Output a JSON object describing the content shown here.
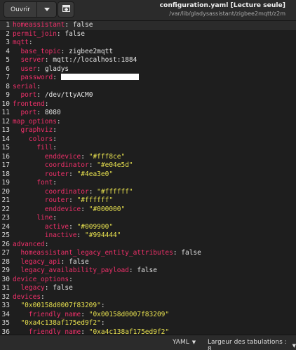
{
  "header": {
    "open_label": "Ouvrir",
    "open_menu_icon": "chevron-down-icon",
    "new_tab_icon": "new-document-icon",
    "title": "configuration.yaml [Lecture seule]",
    "path": "/var/lib/gladysassistant/zigbee2mqtt/z2m"
  },
  "editor": {
    "current_line": 1,
    "lines": [
      {
        "n": "1",
        "indent": "",
        "key": "homeassistant",
        "value": "false",
        "vtype": "plain"
      },
      {
        "n": "2",
        "indent": "",
        "key": "permit_join",
        "value": "false",
        "vtype": "plain"
      },
      {
        "n": "3",
        "indent": "",
        "key": "mqtt",
        "value": "",
        "vtype": "plain"
      },
      {
        "n": "4",
        "indent": "  ",
        "key": "base_topic",
        "value": "zigbee2mqtt",
        "vtype": "plain"
      },
      {
        "n": "5",
        "indent": "  ",
        "key": "server",
        "value": "mqtt://localhost:1884",
        "vtype": "plain"
      },
      {
        "n": "6",
        "indent": "  ",
        "key": "user",
        "value": "gladys",
        "vtype": "plain"
      },
      {
        "n": "7",
        "indent": "  ",
        "key": "password",
        "value": "",
        "vtype": "redacted"
      },
      {
        "n": "8",
        "indent": "",
        "key": "serial",
        "value": "",
        "vtype": "plain"
      },
      {
        "n": "9",
        "indent": "  ",
        "key": "port",
        "value": "/dev/ttyACM0",
        "vtype": "plain"
      },
      {
        "n": "10",
        "indent": "",
        "key": "frontend",
        "value": "",
        "vtype": "plain"
      },
      {
        "n": "11",
        "indent": "  ",
        "key": "port",
        "value": "8080",
        "vtype": "plain"
      },
      {
        "n": "12",
        "indent": "",
        "key": "map_options",
        "value": "",
        "vtype": "plain"
      },
      {
        "n": "13",
        "indent": "  ",
        "key": "graphviz",
        "value": "",
        "vtype": "plain"
      },
      {
        "n": "14",
        "indent": "    ",
        "key": "colors",
        "value": "",
        "vtype": "plain"
      },
      {
        "n": "15",
        "indent": "      ",
        "key": "fill",
        "value": "",
        "vtype": "plain"
      },
      {
        "n": "16",
        "indent": "        ",
        "key": "enddevice",
        "value": "\"#fff8ce\"",
        "vtype": "string"
      },
      {
        "n": "17",
        "indent": "        ",
        "key": "coordinator",
        "value": "\"#e04e5d\"",
        "vtype": "string"
      },
      {
        "n": "18",
        "indent": "        ",
        "key": "router",
        "value": "\"#4ea3e0\"",
        "vtype": "string"
      },
      {
        "n": "19",
        "indent": "      ",
        "key": "font",
        "value": "",
        "vtype": "plain"
      },
      {
        "n": "20",
        "indent": "        ",
        "key": "coordinator",
        "value": "\"#ffffff\"",
        "vtype": "string"
      },
      {
        "n": "21",
        "indent": "        ",
        "key": "router",
        "value": "\"#ffffff\"",
        "vtype": "string"
      },
      {
        "n": "22",
        "indent": "        ",
        "key": "enddevice",
        "value": "\"#000000\"",
        "vtype": "string"
      },
      {
        "n": "23",
        "indent": "      ",
        "key": "line",
        "value": "",
        "vtype": "plain"
      },
      {
        "n": "24",
        "indent": "        ",
        "key": "active",
        "value": "\"#009900\"",
        "vtype": "string"
      },
      {
        "n": "25",
        "indent": "        ",
        "key": "inactive",
        "value": "\"#994444\"",
        "vtype": "string"
      },
      {
        "n": "26",
        "indent": "",
        "key": "advanced",
        "value": "",
        "vtype": "plain"
      },
      {
        "n": "27",
        "indent": "  ",
        "key": "homeassistant_legacy_entity_attributes",
        "value": "false",
        "vtype": "plain"
      },
      {
        "n": "28",
        "indent": "  ",
        "key": "legacy_api",
        "value": "false",
        "vtype": "plain"
      },
      {
        "n": "29",
        "indent": "  ",
        "key": "legacy_availability_payload",
        "value": "false",
        "vtype": "plain"
      },
      {
        "n": "30",
        "indent": "",
        "key": "device_options",
        "value": "",
        "vtype": "plain"
      },
      {
        "n": "31",
        "indent": "  ",
        "key": "legacy",
        "value": "false",
        "vtype": "plain"
      },
      {
        "n": "32",
        "indent": "",
        "key": "devices",
        "value": "",
        "vtype": "plain"
      },
      {
        "n": "33",
        "indent": "  ",
        "key": "\"0x00158d0007f83209\"",
        "value": "",
        "vtype": "plain",
        "key_is_string": true
      },
      {
        "n": "34",
        "indent": "    ",
        "key": "friendly_name",
        "value": "\"0x00158d0007f83209\"",
        "vtype": "string"
      },
      {
        "n": "35",
        "indent": "  ",
        "key": "\"0xa4c138af175ed9f2\"",
        "value": "",
        "vtype": "plain",
        "key_is_string": true
      },
      {
        "n": "36",
        "indent": "    ",
        "key": "friendly_name",
        "value": "\"0xa4c138af175ed9f2\"",
        "vtype": "string"
      },
      {
        "n": "37",
        "indent": "  ",
        "key": "\"0xa4c1388f14e47818\"",
        "value": "",
        "vtype": "plain",
        "key_is_string": true
      }
    ]
  },
  "status": {
    "language": "YAML",
    "tabs_label": "Largeur des tabulations : 8"
  },
  "colors": {
    "key": "#f0306a",
    "string": "#e7e04f",
    "background": "#1e1e1e"
  }
}
